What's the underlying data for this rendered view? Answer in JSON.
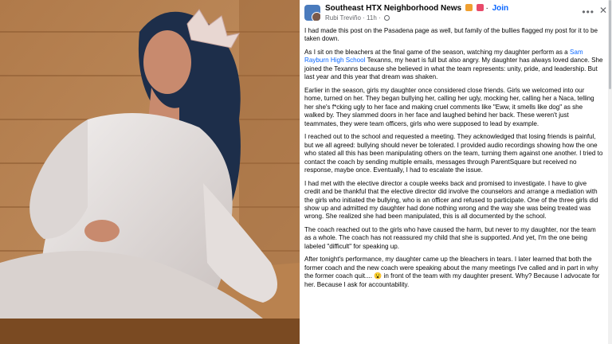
{
  "post": {
    "group_name": "Southeast HTX Neighborhood News",
    "join_label": "Join",
    "author": "Rubi Treviño",
    "time": "11h",
    "more_label": "•••",
    "close_label": "✕",
    "paragraphs": [
      {
        "text": "I had made this post on the Pasadena page as well, but family of the bullies flagged my post for it to be taken down."
      },
      {
        "pre": "As I sit on the bleachers at the final game of the season, watching my daughter perform as a ",
        "link": "Sam Rayburn High School",
        "post": " Texanns, my heart is full but also angry. My daughter has always loved dance. She joined the Texanns because she believed in what the team represents: unity, pride, and leadership. But last year and this year that dream was shaken."
      },
      {
        "text": "Earlier in the season, girls my daughter once considered close friends. Girls we welcomed into our home, turned on her. They began bullying her, calling her ugly, mocking her, calling her a Naca, telling her she's f*cking ugly to her face and making cruel comments like \"Eww, it smells like dog\" as she walked by. They slammed doors in her face and laughed behind her back. These weren't just teammates, they were team officers, girls who were supposed to lead by example."
      },
      {
        "text": "I reached out to the school and requested a meeting. They acknowledged that losing friends is painful, but we all agreed: bullying should never be tolerated. I provided audio recordings showing how the one who stated all this has been manipulating others on the team, turning them against one another. I tried to contact the coach by sending multiple emails, messages through ParentSquare but received no response, maybe once. Eventually, I had to escalate the issue."
      },
      {
        "text": "I had met with the elective director a couple weeks back and promised to investigate. I have to give credit and be thankful that the elective director did involve the counselors and arrange a mediation with the girls who initiated the bullying, who is an officer and refused to participate. One of the three girls did show up and admitted my daughter had done nothing wrong and the way she was being treated was wrong. She realized she had been manipulated, this is all documented by the school."
      },
      {
        "text": "The coach reached out to the girls who have caused the harm, but never to my daughter, nor the team as a whole. The coach has not reassured my child that she is supported. And yet, I'm the one being labeled \"difficult\" for speaking up."
      },
      {
        "text": "After tonight's performance, my daughter came up the bleachers in tears. I later learned that both the former coach and the new coach were speaking about the many meetings I've called and in part in why the former coach quit.... 😮 in front of the team with my daughter present. Why? Because I advocate for her. Because I ask for accountability."
      }
    ]
  },
  "colors": {
    "link": "#0866ff",
    "text": "#050505",
    "muted": "#65676b"
  }
}
